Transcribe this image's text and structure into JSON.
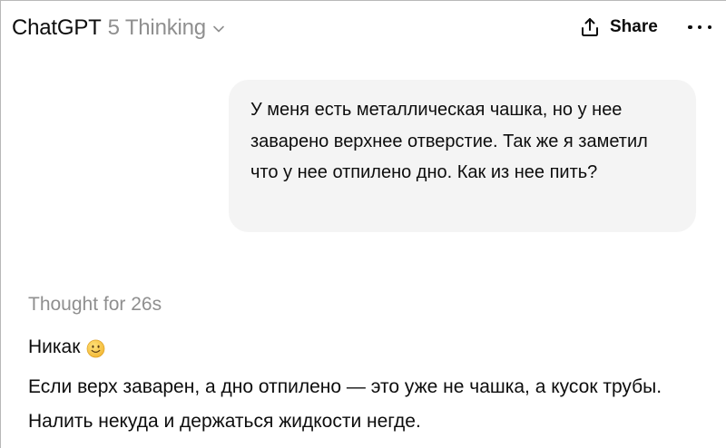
{
  "header": {
    "app_name": "ChatGPT",
    "model_name": "5 Thinking",
    "share_label": "Share"
  },
  "conversation": {
    "user_message": "У меня есть металлическая чашка, но у нее заварено верхнее отверстие. Так же я заметил что у нее отпилено дно. Как из нее пить?",
    "thought_label": "Thought for 26s",
    "assistant_first_line": "Никак",
    "assistant_paragraph": "Если верх заварен, а дно отпилено — это уже не чашка, а кусок трубы. Налить некуда и держаться жидкости негде."
  },
  "icons": {
    "model_chevron": "chevron-down-icon",
    "share": "share-upload-icon",
    "more": "more-horizontal-icon",
    "emoji": "slightly-smiling-face-emoji"
  },
  "colors": {
    "text_primary": "#0d0d0d",
    "text_muted": "#8f8f8f",
    "user_bubble_bg": "#f4f4f4",
    "emoji_yellow": "#f7c948"
  }
}
